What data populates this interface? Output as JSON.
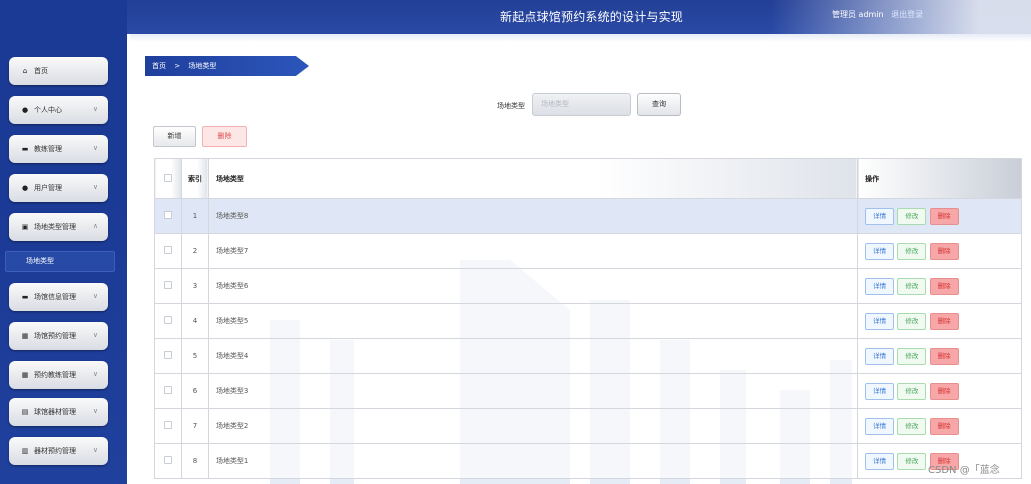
{
  "header": {
    "title": "新起点球馆预约系统的设计与实现",
    "user_label": "管理员 admin",
    "logout_label": "退出登录"
  },
  "sidebar": {
    "items": [
      {
        "label": "首页",
        "icon": "home-icon",
        "glyph": "⌂"
      },
      {
        "label": "个人中心",
        "icon": "user-icon",
        "glyph": "●"
      },
      {
        "label": "教练管理",
        "icon": "briefcase-icon",
        "glyph": "▬"
      },
      {
        "label": "用户管理",
        "icon": "user-icon",
        "glyph": "●"
      },
      {
        "label": "场地类型管理",
        "icon": "clipboard-icon",
        "glyph": "▣"
      },
      {
        "label": "场馆信息管理",
        "icon": "monitor-icon",
        "glyph": "▬"
      },
      {
        "label": "场馆预约管理",
        "icon": "grid-icon",
        "glyph": "▦"
      },
      {
        "label": "预约教练管理",
        "icon": "grid-icon",
        "glyph": "▦"
      },
      {
        "label": "球馆器材管理",
        "icon": "keyboard-icon",
        "glyph": "▤"
      },
      {
        "label": "器材预约管理",
        "icon": "book-icon",
        "glyph": "▥"
      }
    ],
    "active_sub": "场地类型"
  },
  "breadcrumb": {
    "home": "首页",
    "separator": ">",
    "current": "场地类型"
  },
  "search": {
    "label": "场地类型",
    "placeholder": "场地类型",
    "query_button": "查询"
  },
  "actions": {
    "add": "新增",
    "delete": "删除"
  },
  "table": {
    "columns": [
      "",
      "索引",
      "场地类型",
      "操作"
    ],
    "rows": [
      {
        "index": "1",
        "name": "场地类型8",
        "selected": true
      },
      {
        "index": "2",
        "name": "场地类型7",
        "selected": false
      },
      {
        "index": "3",
        "name": "场地类型6",
        "selected": false
      },
      {
        "index": "4",
        "name": "场地类型5",
        "selected": false
      },
      {
        "index": "5",
        "name": "场地类型4",
        "selected": false
      },
      {
        "index": "6",
        "name": "场地类型3",
        "selected": false
      },
      {
        "index": "7",
        "name": "场地类型2",
        "selected": false
      },
      {
        "index": "8",
        "name": "场地类型1",
        "selected": false
      }
    ],
    "row_actions": {
      "detail": "详情",
      "edit": "修改",
      "delete": "删除"
    }
  },
  "watermark": "CSDN @「蓝念",
  "colors": {
    "header_bg": "#233f96",
    "sidebar_bg": "#1b3a95",
    "selected_row": "#dfe6f5",
    "delete_red": "#e04b4b"
  }
}
